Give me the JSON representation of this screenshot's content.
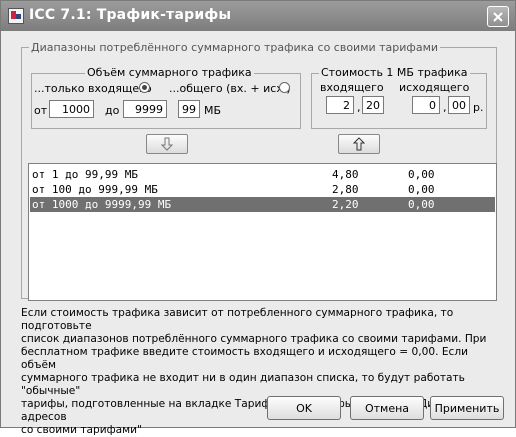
{
  "window": {
    "title": "ICC 7.1: Трафик-тарифы"
  },
  "group": {
    "legend": "Диапазоны потреблённого суммарного трафика со своими тарифами"
  },
  "volume": {
    "legend": "Объём суммарного трафика",
    "incoming_label": "...только входящего",
    "total_label": "...общего (вх. + исх.)",
    "selected": "incoming",
    "from_label": "от",
    "from_value": "1000",
    "to_label": "до",
    "to_int": "9999",
    "to_frac": "99",
    "unit": "МБ"
  },
  "cost": {
    "legend": "Стоимость 1 МБ трафика",
    "incoming_label": "входящего",
    "outgoing_label": "исходящего",
    "in_int": "2",
    "in_frac": "20",
    "out_int": "0",
    "out_frac": "00",
    "comma": ",",
    "currency": "р."
  },
  "icons": {
    "down": "arrow-down-icon",
    "up": "arrow-up-icon",
    "close": "close-icon",
    "app": "app-icon"
  },
  "ranges": [
    {
      "range": "от 1 до 99,99 МБ",
      "in": "4,80",
      "out": "0,00",
      "selected": false
    },
    {
      "range": "от 100 до 999,99 МБ",
      "in": "2,80",
      "out": "0,00",
      "selected": false
    },
    {
      "range": "от 1000 до 9999,99 МБ",
      "in": "2,20",
      "out": "0,00",
      "selected": true
    }
  ],
  "info": {
    "lines": [
      "Если стоимость трафика зависит от потребленного суммарного трафика, то подготовьте",
      "список диапазонов потреблённого суммарного трафика со своими тарифами. При",
      "бесплатном трафике введите стоимость входящего и исходящего = 0,00. Если объём",
      "суммарного трафика не входит ни в один диапазон списка, то будут работать \"обычные\"",
      "тарифы, подготовленные на вкладке Тарифы, или тарифы из списка \"Диапазоны IP-адресов",
      "со своими тарифами\""
    ]
  },
  "buttons": {
    "ok": "OK",
    "cancel": "Отмена",
    "apply": "Применить"
  }
}
